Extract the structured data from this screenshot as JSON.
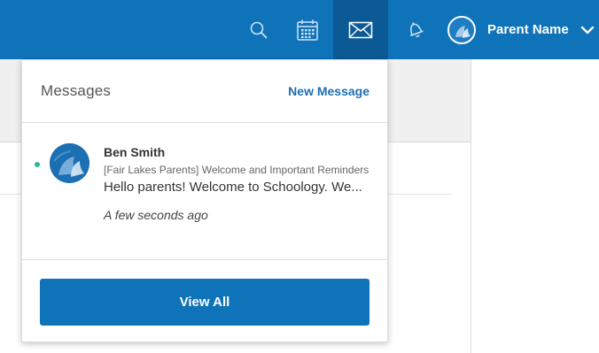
{
  "topbar": {
    "bg_color": "#0f73b9",
    "active_bg_color": "#0c5a95",
    "icons": {
      "search": "search-icon",
      "calendar": "calendar-icon",
      "messages": "envelope-icon",
      "notifications": "bell-icon"
    },
    "user": {
      "name": "Parent Name",
      "avatar": "avatar-icon",
      "menu_icon": "chevron-down-icon"
    }
  },
  "messages_dropdown": {
    "title": "Messages",
    "new_message_label": "New Message",
    "items": [
      {
        "sender": "Ben Smith",
        "subject": "[Fair Lakes Parents] Welcome and Important Reminders",
        "preview": "Hello parents! Welcome to Schoology. We...",
        "time": "A few seconds ago",
        "unread": true,
        "unread_color": "#29b899"
      }
    ],
    "view_all_label": "View All",
    "accent_color": "#1f6fb0"
  }
}
